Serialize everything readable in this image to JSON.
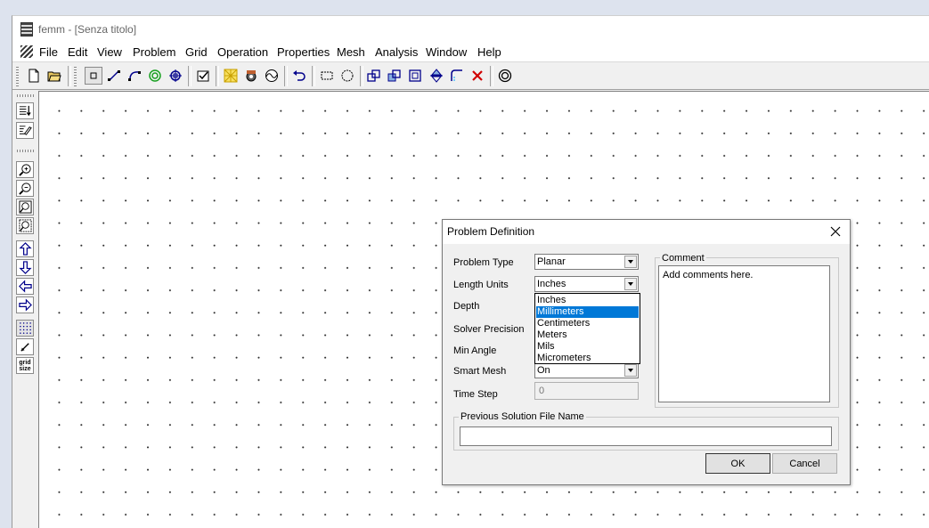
{
  "window": {
    "title": "femm - [Senza titolo]"
  },
  "menu": {
    "items": [
      {
        "label": "File"
      },
      {
        "label": "Edit"
      },
      {
        "label": "View"
      },
      {
        "label": "Problem"
      },
      {
        "label": "Grid"
      },
      {
        "label": "Operation"
      },
      {
        "label": "Properties"
      },
      {
        "label": "Mesh"
      },
      {
        "label": "Analysis"
      },
      {
        "label": "Window"
      },
      {
        "label": "Help"
      }
    ]
  },
  "left_toolbar": {
    "grid_size_label_1": "grid",
    "grid_size_label_2": "size"
  },
  "dialog": {
    "title": "Problem Definition",
    "problem_type_label": "Problem Type",
    "problem_type_value": "Planar",
    "length_units_label": "Length Units",
    "length_units_value": "Inches",
    "length_units_options": [
      "Inches",
      "Millimeters",
      "Centimeters",
      "Meters",
      "Mils",
      "Micrometers"
    ],
    "length_units_highlighted": "Millimeters",
    "depth_label": "Depth",
    "solver_precision_label": "Solver Precision",
    "min_angle_label": "Min Angle",
    "smart_mesh_label": "Smart Mesh",
    "smart_mesh_value": "On",
    "time_step_label": "Time Step",
    "time_step_value": "0",
    "comment_label": "Comment",
    "comment_text": "Add comments here.",
    "prev_solution_label": "Previous Solution File Name",
    "prev_solution_value": "",
    "ok_label": "OK",
    "cancel_label": "Cancel"
  },
  "colors": {
    "selection": "#0078d7",
    "desktop": "#dde3ee",
    "canvas": "#ffffff"
  }
}
